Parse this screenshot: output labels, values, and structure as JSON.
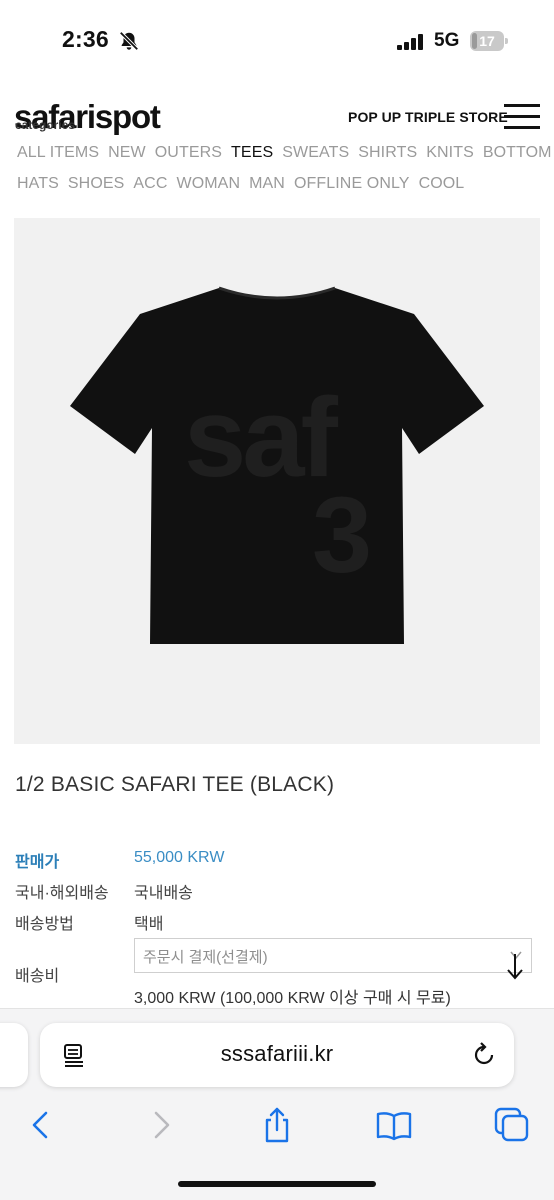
{
  "status_bar": {
    "time": "2:36",
    "network": "5G",
    "battery_level": "17",
    "battery_fraction": 0.17,
    "icons": [
      "bell-slash-icon",
      "signal-icon",
      "battery-icon"
    ]
  },
  "header": {
    "logo": "safarispot",
    "categories_label": "categories",
    "popup_link": "POP UP TRIPLE STORE",
    "menu_icon": "hamburger-icon"
  },
  "categories": {
    "row1": [
      "ALL ITEMS",
      "NEW",
      "OUTERS",
      "TEES",
      "SWEATS",
      "SHIRTS",
      "KNITS",
      "BOTTOM"
    ],
    "row2": [
      "HATS",
      "SHOES",
      "ACC",
      "WOMAN",
      "MAN",
      "OFFLINE ONLY",
      "COOL"
    ],
    "active": "TEES"
  },
  "product": {
    "image_text_line1": "saf",
    "image_text_line2": "3",
    "title": "1/2 BASIC SAFARI TEE (BLACK)",
    "price_label": "판매가",
    "price_value": "55,000 KRW",
    "shipping_region_label": "국내·해외배송",
    "shipping_region_value": "국내배송",
    "shipping_method_label": "배송방법",
    "shipping_method_value": "택배",
    "shipping_fee_label": "배송비",
    "shipping_select_value": "주문시 결제(선결제)",
    "shipping_fee_note": "3,000 KRW (100,000 KRW 이상 구매 시 무료)"
  },
  "colors": {
    "accent_blue": "#2c7fb8",
    "shirt": "#111111",
    "shirt_print": "#1f1f1f",
    "image_bg": "#f1f1f1",
    "inactive_category": "#9a9a9a",
    "safari_blue": "#1a73e8"
  },
  "browser": {
    "url": "sssafariii.kr",
    "toolbar_icons": [
      "back-icon",
      "forward-icon",
      "share-icon",
      "bookmarks-icon",
      "tabs-icon"
    ]
  }
}
